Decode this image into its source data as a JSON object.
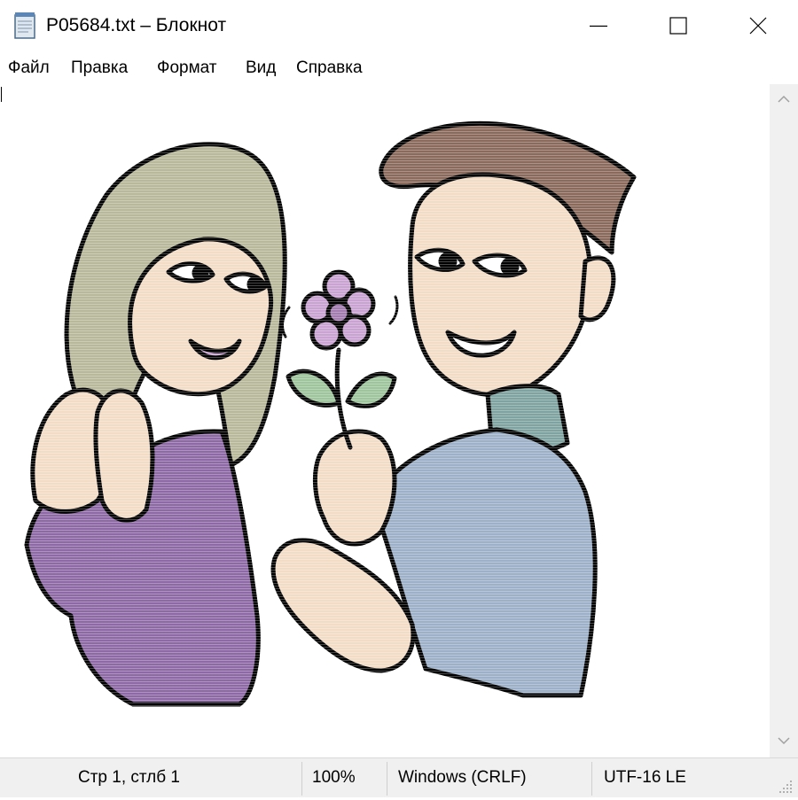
{
  "window": {
    "title": "P05684.txt – Блокнот",
    "app_icon": "notepad-icon",
    "controls": {
      "minimize_icon": "minimize-icon",
      "maximize_icon": "maximize-icon",
      "close_icon": "close-icon"
    }
  },
  "menu": {
    "file": "Файл",
    "edit": "Правка",
    "format": "Формат",
    "view": "Вид",
    "help": "Справка"
  },
  "editor": {
    "content": "ASCII-art picture: a smiling woman with long hair and a young man offering her a pink flower",
    "colors": {
      "woman_hair": "#b8b89a",
      "woman_sweater": "#8d6aa5",
      "man_hair": "#8a6a5a",
      "man_sweater": "#9cb0c8",
      "collar": "#7fa3a0",
      "skin": "#f2dcc6",
      "petals": "#c9a3d1",
      "leaves": "#9ec59c",
      "outline": "#000000"
    }
  },
  "scrollbar": {
    "up_icon": "chevron-up-icon",
    "down_icon": "chevron-down-icon"
  },
  "status": {
    "position": "Стр 1, стлб 1",
    "zoom": "100%",
    "line_endings": "Windows (CRLF)",
    "encoding": "UTF-16 LE",
    "grip_icon": "resize-grip-icon"
  }
}
